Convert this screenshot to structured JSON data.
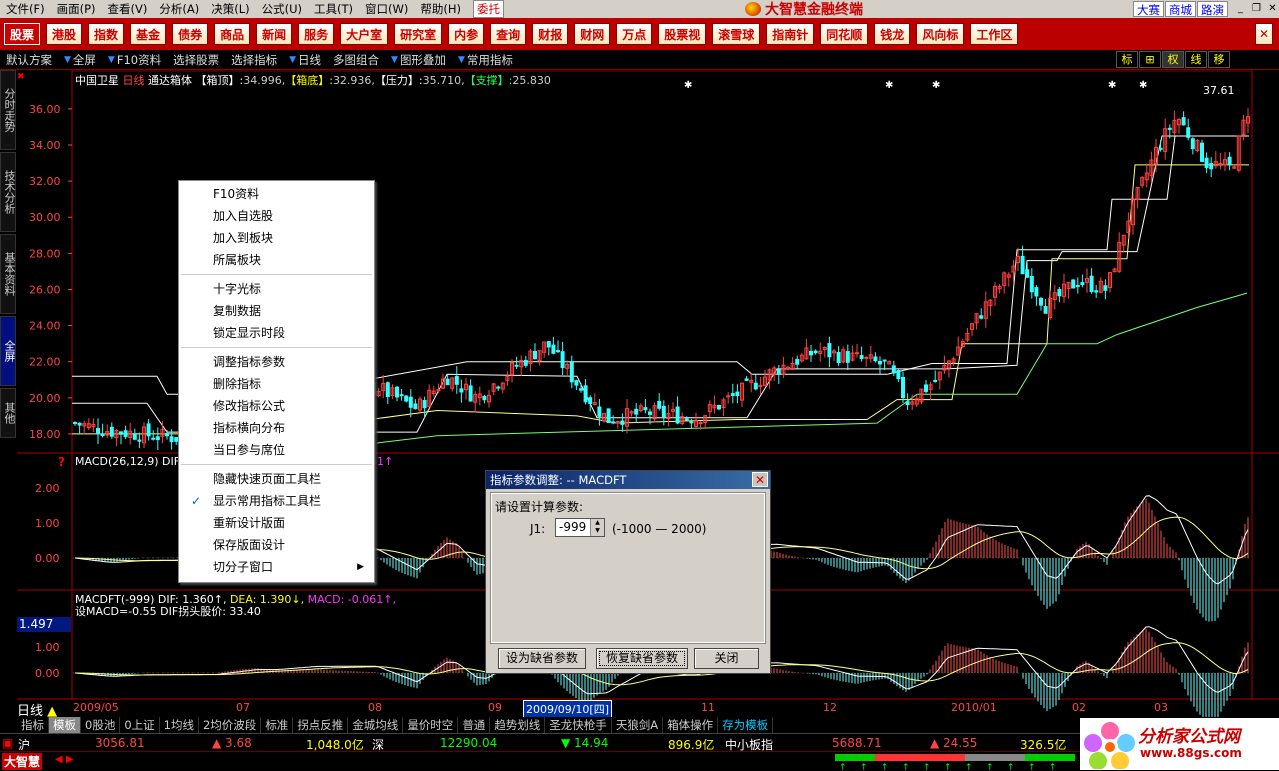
{
  "menubar": {
    "items": [
      "文件(F)",
      "画面(P)",
      "查看(V)",
      "分析(A)",
      "决策(L)",
      "公式(U)",
      "工具(T)",
      "窗口(W)",
      "帮助(H)"
    ],
    "weituo": "委托",
    "app_title": "大智慧金融终端",
    "links": [
      "大赛",
      "商城",
      "路演"
    ]
  },
  "navbar": {
    "items": [
      "股票",
      "港股",
      "指数",
      "基金",
      "债券",
      "商品",
      "新闻",
      "服务",
      "大户室",
      "研究室",
      "内参",
      "查询",
      "财报",
      "财网",
      "万点",
      "股票视",
      "滚雪球",
      "指南针",
      "同花顺",
      "钱龙",
      "风向标",
      "工作区"
    ]
  },
  "toolbar": {
    "items": [
      "默认方案",
      "全屏",
      "F10资料",
      "选择股票",
      "选择指标",
      "日线",
      "多图组合",
      "图形叠加",
      "常用指标"
    ],
    "right": [
      "标",
      "⊞",
      "权",
      "线",
      "移"
    ]
  },
  "sidetabs": [
    "分时走势",
    "技术分析",
    "基本资料",
    "全屏",
    "其他"
  ],
  "main_header": {
    "stock": "中国卫星",
    "period": "日线",
    "indicator": "通达箱体",
    "items": [
      {
        "label": "【箱顶】:",
        "value": "34.996,",
        "color": "#ffffff"
      },
      {
        "label": "【箱底】:",
        "value": "32.936,",
        "color": "#ffff00"
      },
      {
        "label": "【压力】:",
        "value": "35.710,",
        "color": "#ffffff"
      },
      {
        "label": "【支撑】:",
        "value": "25.830",
        "color": "#22ff55"
      }
    ],
    "high_label": "37.61"
  },
  "macd_header": {
    "name": "MACD(26,12,9)",
    "text": "DIF",
    "tail": "61↑"
  },
  "macdft_header": {
    "line1_parts": [
      {
        "t": "MACDFT(-999)",
        "c": "#ffffff"
      },
      {
        "t": " DIF: 1.360↑,",
        "c": "#ffffff"
      },
      {
        "t": " DEA: 1.390↓,",
        "c": "#ffff00"
      },
      {
        "t": " MACD: -0.061↑,",
        "c": "#ff33ff"
      }
    ],
    "line2": "设MACD=-0.55 DIF拐头股价: 33.40"
  },
  "value_box": "1.497",
  "context_menu": {
    "groups": [
      [
        "F10资料",
        "加入自选股",
        "加入到板块",
        "所属板块"
      ],
      [
        "十字光标",
        "复制数据",
        "锁定显示时段"
      ],
      [
        "调整指标参数",
        "删除指标",
        "修改指标公式",
        "指标横向分布",
        "当日参与席位"
      ],
      [
        "隐藏快速页面工具栏",
        "显示常用指标工具栏",
        "重新设计版面",
        "保存版面设计",
        "切分子窗口"
      ]
    ],
    "checked": "显示常用指标工具栏",
    "submenu": "切分子窗口"
  },
  "dialog": {
    "title": "指标参数调整: -- MACDFT",
    "prompt": "请设置计算参数:",
    "param_name": "J1:",
    "param_value": "-999",
    "range": "(-1000 — 2000)",
    "btn_default": "设为缺省参数",
    "btn_restore": "恢复缺省参数",
    "btn_close": "关闭"
  },
  "date_axis": {
    "labels": [
      "2009/05",
      "07",
      "08",
      "09",
      "11",
      "12",
      "2010/01",
      "02",
      "03"
    ],
    "current": "2009/09/10[四]"
  },
  "period_label": "日线",
  "tabbar": [
    "指标",
    "模板",
    "0股池",
    "0上证",
    "1均线",
    "2均价波段",
    "标准",
    "拐点反推",
    "金城均线",
    "量价时空",
    "普通",
    "趋势划线",
    "圣龙快枪手",
    "天狼剑A",
    "箱体操作",
    "存为模板"
  ],
  "quotes": {
    "sh_label": "沪",
    "sh_index": "3056.81",
    "sh_change": "▲ 3.68",
    "sh_amount": "1,048.0亿",
    "sz_label": "深",
    "sz_index": "12290.04",
    "sz_change": "▼ 14.94",
    "sz_amount": "896.9亿",
    "sme_label": "中小板指",
    "sme_index": "5688.71",
    "sme_change": "▲ 24.55",
    "sme_amount": "326.5亿"
  },
  "status": {
    "brand": "大智慧"
  },
  "watermark": {
    "title": "分析家公式网",
    "url": "www.88gs.com"
  },
  "chart_data": {
    "type": "candlestick",
    "y_ticks_main": [
      "36.00",
      "34.00",
      "32.00",
      "30.00",
      "28.00",
      "26.00",
      "24.00",
      "22.00",
      "20.00",
      "18.00"
    ],
    "ylim_main": [
      17.0,
      37.6
    ],
    "y_ticks_macd": [
      "2.00",
      "1.00",
      "0.00"
    ],
    "y_ticks_macdft": [
      "1.00",
      "0.00"
    ]
  }
}
